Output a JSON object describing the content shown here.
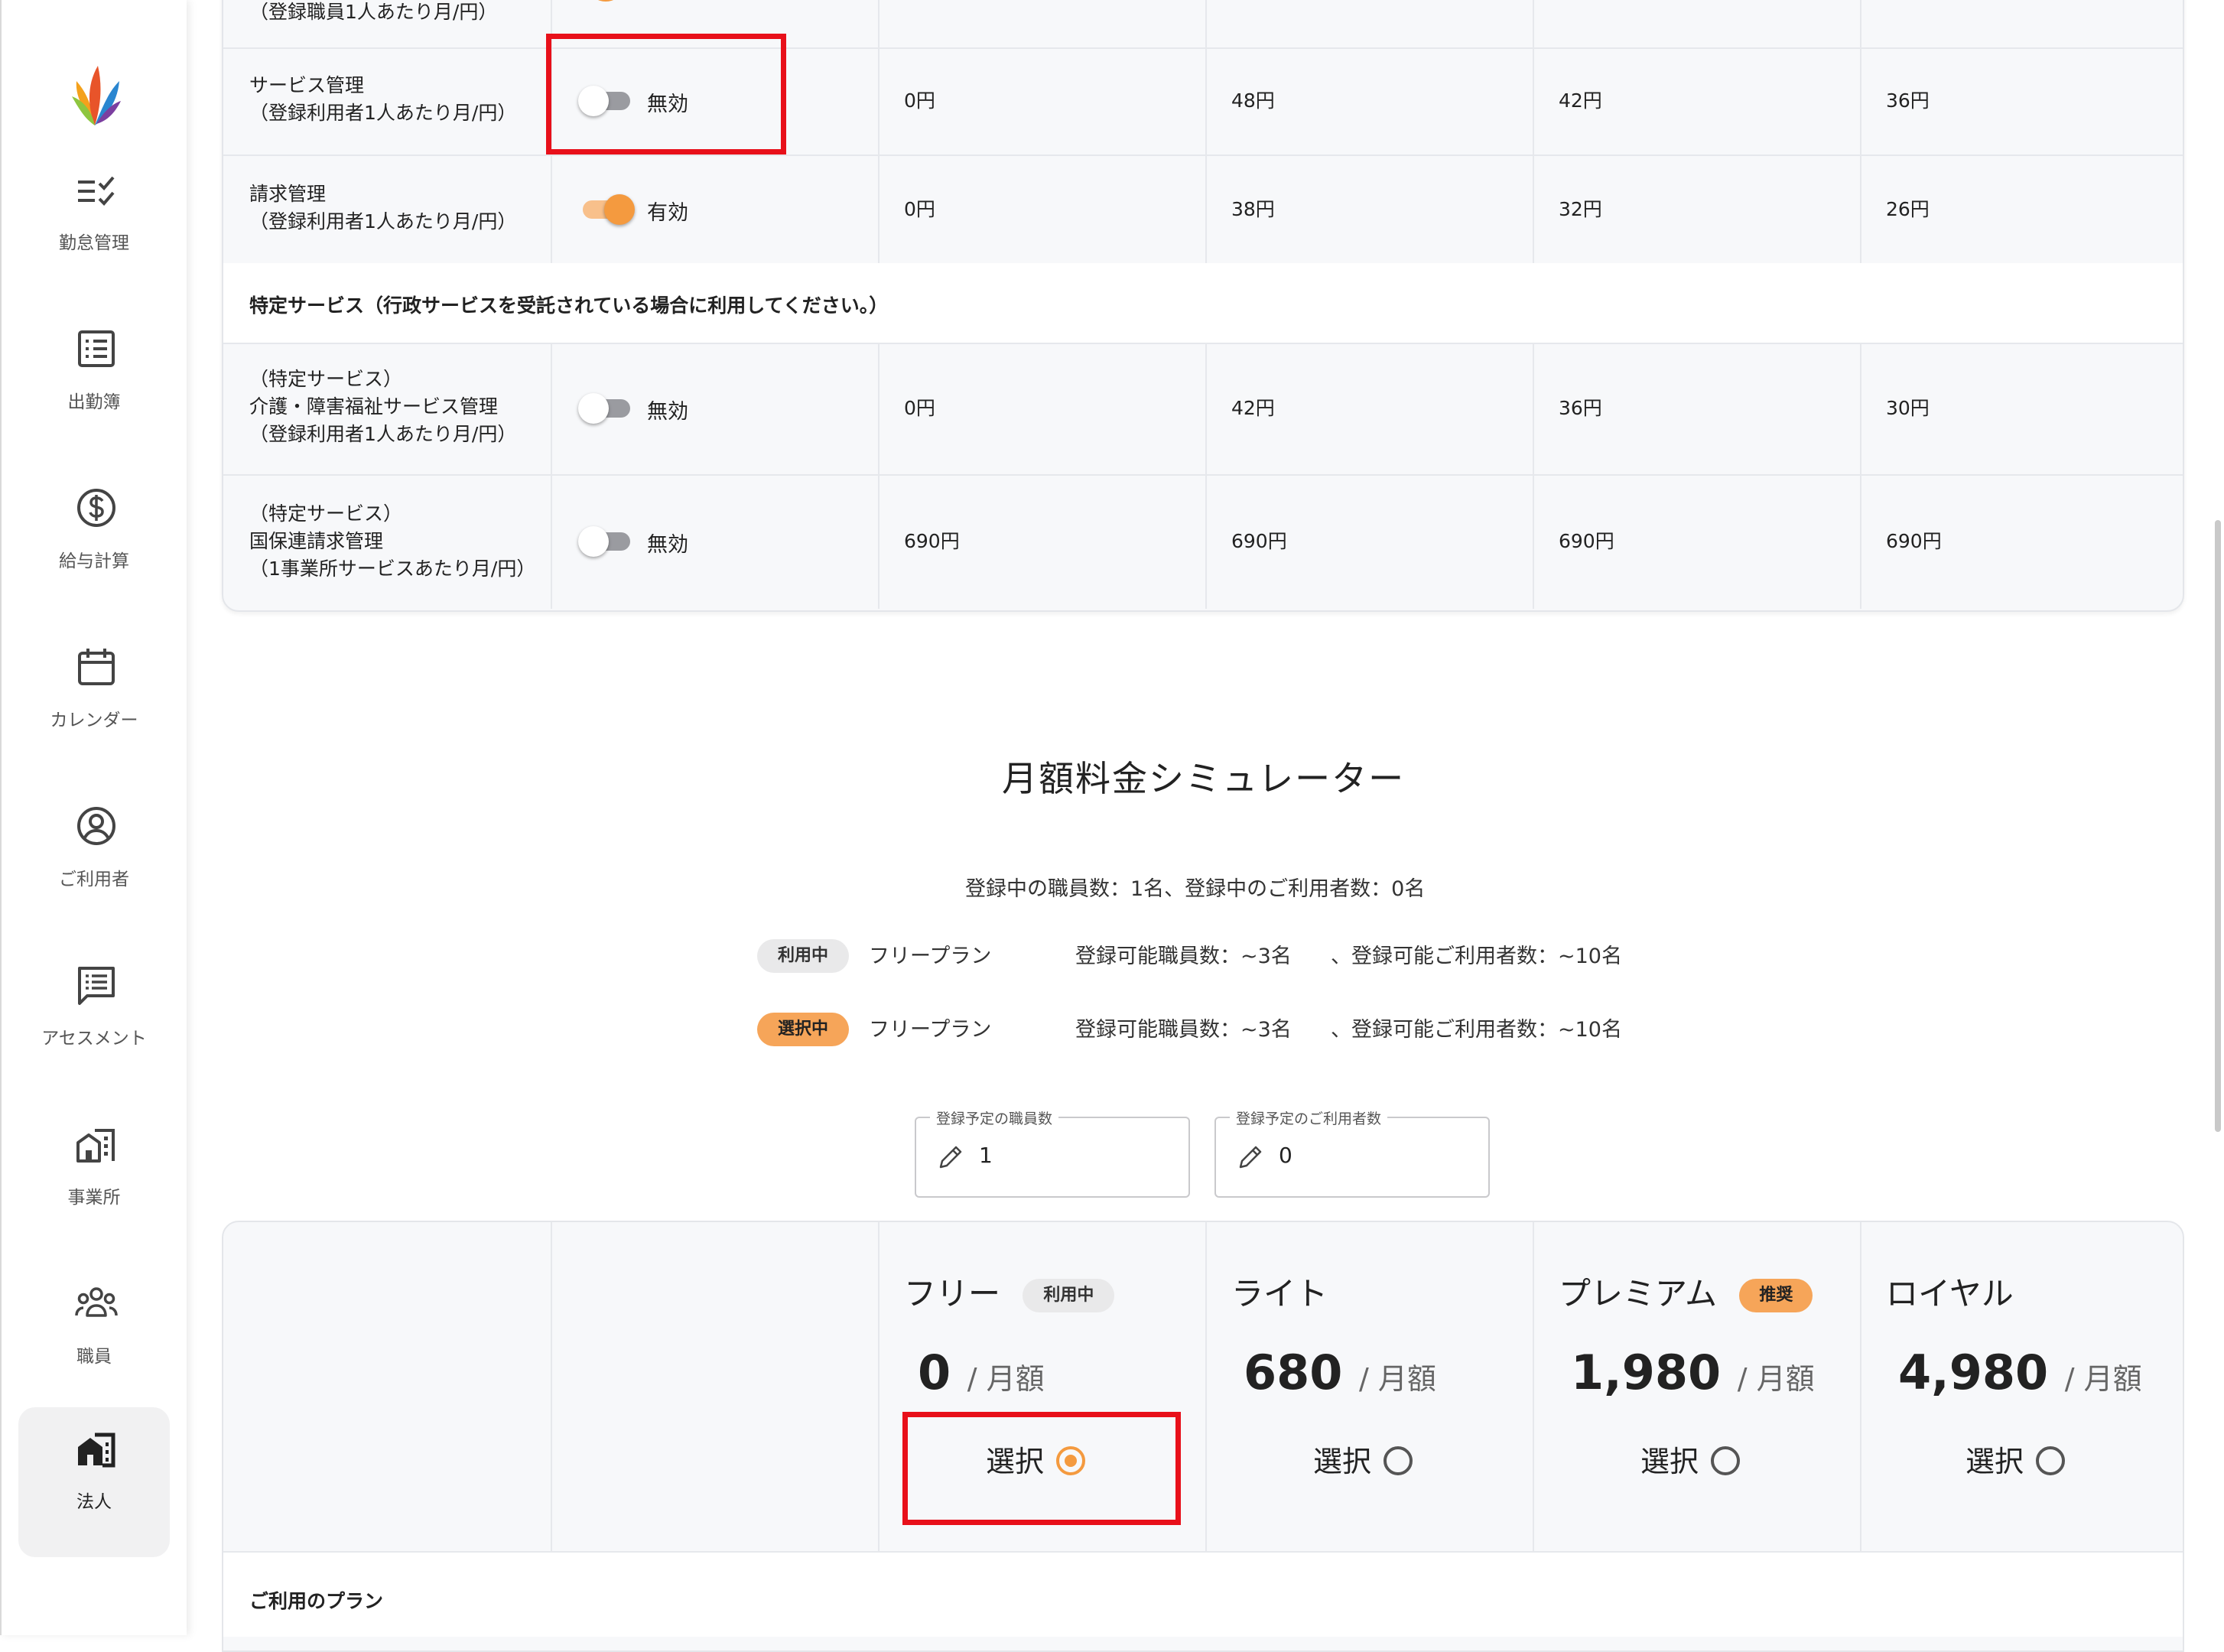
{
  "sidebar": {
    "logo": "app-logo",
    "items": [
      {
        "label": "勤怠管理",
        "icon": "checklist-icon"
      },
      {
        "label": "出勤簿",
        "icon": "list-document-icon"
      },
      {
        "label": "給与計算",
        "icon": "dollar-icon"
      },
      {
        "label": "カレンダー",
        "icon": "calendar-icon"
      },
      {
        "label": "ご利用者",
        "icon": "user-circle-icon"
      },
      {
        "label": "アセスメント",
        "icon": "comment-list-icon"
      },
      {
        "label": "事業所",
        "icon": "office-building-icon"
      },
      {
        "label": "職員",
        "icon": "group-icon"
      },
      {
        "label": "法人",
        "icon": "corporation-icon",
        "active": true
      }
    ]
  },
  "options_table": {
    "rows": [
      {
        "name": "（登録職員1人あたり月/円）",
        "partial": true
      },
      {
        "name_line1": "サービス管理",
        "name_line2": "（登録利用者1人あたり月/円）",
        "toggle": "無効",
        "enabled": false,
        "prices": [
          "0円",
          "48円",
          "42円",
          "36円"
        ]
      },
      {
        "name_line1": "請求管理",
        "name_line2": "（登録利用者1人あたり月/円）",
        "toggle": "有効",
        "enabled": true,
        "prices": [
          "0円",
          "38円",
          "32円",
          "26円"
        ]
      }
    ],
    "special_section_title": "特定サービス（行政サービスを受託されている場合に利用してください。）",
    "special_rows": [
      {
        "name_line1": "（特定サービス）",
        "name_line2": "介護・障害福祉サービス管理",
        "name_line3": "（登録利用者1人あたり月/円）",
        "toggle": "無効",
        "enabled": false,
        "prices": [
          "0円",
          "42円",
          "36円",
          "30円"
        ]
      },
      {
        "name_line1": "（特定サービス）",
        "name_line2": "国保連請求管理",
        "name_line3": "（1事業所サービスあたり月/円）",
        "toggle": "無効",
        "enabled": false,
        "prices": [
          "690円",
          "690円",
          "690円",
          "690円"
        ]
      }
    ]
  },
  "simulator": {
    "title": "月額料金シミュレーター",
    "counts": "登録中の職員数：1名、登録中のご利用者数：0名",
    "current": {
      "badge": "利用中",
      "plan": "フリープラン",
      "staff": "登録可能職員数：~3名",
      "users": "、登録可能ご利用者数：~10名"
    },
    "selected": {
      "badge": "選択中",
      "plan": "フリープラン",
      "staff": "登録可能職員数：~3名",
      "users": "、登録可能ご利用者数：~10名"
    },
    "staff_input": {
      "label": "登録予定の職員数",
      "value": "1"
    },
    "users_input": {
      "label": "登録予定のご利用者数",
      "value": "0"
    }
  },
  "plans": [
    {
      "name": "フリー",
      "badge": "利用中",
      "price": "0",
      "unit": "/ 月額",
      "select": "選択",
      "checked": true
    },
    {
      "name": "ライト",
      "price": "680",
      "unit": "/ 月額",
      "select": "選択",
      "checked": false
    },
    {
      "name": "プレミアム",
      "badge": "推奨",
      "price": "1,980",
      "unit": "/ 月額",
      "select": "選択",
      "checked": false
    },
    {
      "name": "ロイヤル",
      "price": "4,980",
      "unit": "/ 月額",
      "select": "選択",
      "checked": false
    }
  ],
  "plans_footer_title": "ご利用のプラン",
  "colors": {
    "accent": "#f49a3f",
    "highlight": "#e8101a"
  }
}
